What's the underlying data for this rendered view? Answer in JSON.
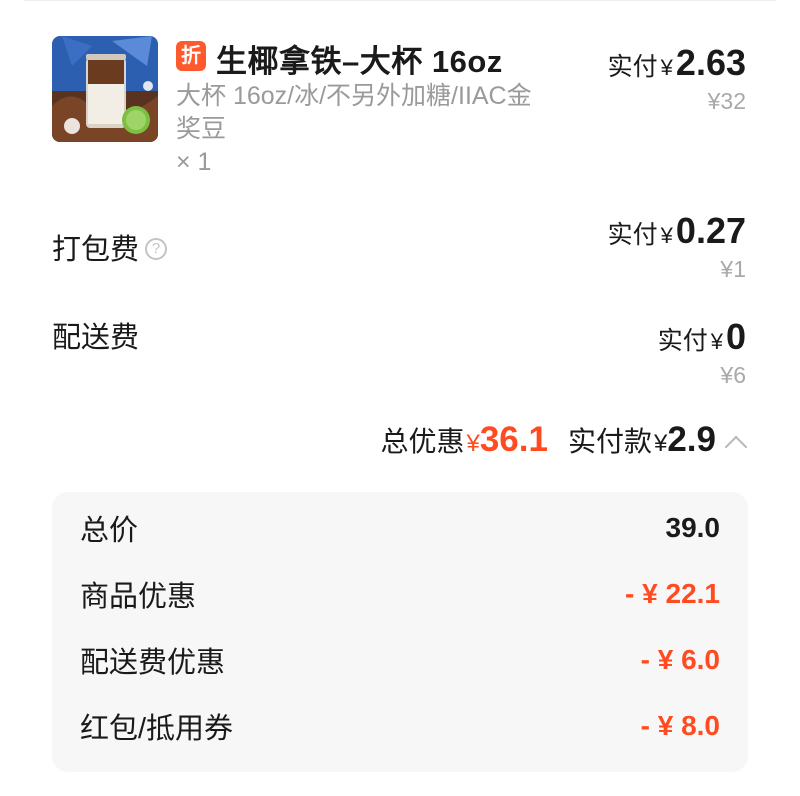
{
  "colors": {
    "accent_red": "#ff4b1f",
    "tag_bg": "#ff5a2e",
    "muted": "#9a9a9a"
  },
  "product": {
    "image_icon": "iced-latte-cup-image",
    "discount_tag": "折",
    "name": "生椰拿铁–大杯 16oz",
    "spec": "大杯 16oz/冰/不另外加糖/IIAC金奖豆",
    "quantity": "× 1",
    "paid_label": "实付",
    "currency": "¥",
    "paid_amount": "2.63",
    "original_price": "¥32"
  },
  "packing_fee": {
    "label": "打包费",
    "help_icon": "question-circle-icon",
    "help_glyph": "?",
    "paid_label": "实付",
    "currency": "¥",
    "paid_amount": "0.27",
    "original_price": "¥1"
  },
  "delivery_fee": {
    "label": "配送费",
    "paid_label": "实付",
    "currency": "¥",
    "paid_amount": "0",
    "original_price": "¥6"
  },
  "summary": {
    "discount_label": "总优惠",
    "discount_currency": "¥",
    "discount_amount": "36.1",
    "paid_label": "实付款",
    "paid_currency": "¥",
    "paid_amount": "2.9",
    "toggle_icon": "chevron-up-icon"
  },
  "breakdown": {
    "rows": [
      {
        "label": "总价",
        "value": "39.0"
      },
      {
        "label": "商品优惠",
        "value": "- ¥ 22.1"
      },
      {
        "label": "配送费优惠",
        "value": "- ¥ 6.0"
      },
      {
        "label": "红包/抵用券",
        "value": "- ¥ 8.0"
      }
    ]
  }
}
